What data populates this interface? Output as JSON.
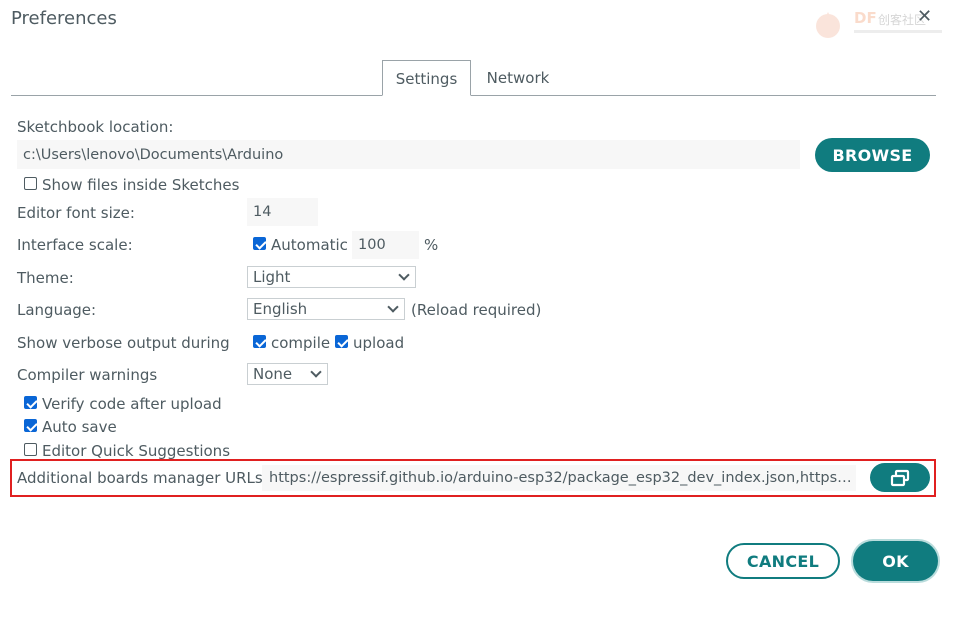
{
  "window": {
    "title": "Preferences",
    "close_glyph": "✕"
  },
  "watermark": {
    "logo": "DF",
    "text": "创客社区"
  },
  "tabs": [
    {
      "label": "Settings",
      "active": true
    },
    {
      "label": "Network",
      "active": false
    }
  ],
  "sketchbook": {
    "label": "Sketchbook location:",
    "value": "c:\\Users\\lenovo\\Documents\\Arduino",
    "browse_label": "BROWSE"
  },
  "show_files": {
    "label": "Show files inside Sketches",
    "checked": false
  },
  "font_size": {
    "label": "Editor font size:",
    "value": "14"
  },
  "interface_scale": {
    "label": "Interface scale:",
    "automatic_label": "Automatic",
    "automatic_checked": true,
    "value": "100",
    "unit": "%"
  },
  "theme": {
    "label": "Theme:",
    "selected": "Light"
  },
  "language": {
    "label": "Language:",
    "selected": "English",
    "note": "(Reload required)"
  },
  "verbose": {
    "label": "Show verbose output during",
    "compile_label": "compile",
    "compile_checked": true,
    "upload_label": "upload",
    "upload_checked": true
  },
  "compiler_warnings": {
    "label": "Compiler warnings",
    "selected": "None"
  },
  "verify": {
    "label": "Verify code after upload",
    "checked": true
  },
  "auto_save": {
    "label": "Auto save",
    "checked": true
  },
  "quick_suggestions": {
    "label": "Editor Quick Suggestions",
    "checked": false
  },
  "boards_urls": {
    "label": "Additional boards manager URLs:",
    "value": "https://espressif.github.io/arduino-esp32/package_esp32_dev_index.json,https:/...",
    "edit_icon": "window-copy-icon"
  },
  "footer": {
    "cancel_label": "CANCEL",
    "ok_label": "OK"
  },
  "colors": {
    "accent": "#107c7f",
    "checkbox": "#0a66d6",
    "highlight": "#e02020",
    "text": "#4e5b61"
  }
}
